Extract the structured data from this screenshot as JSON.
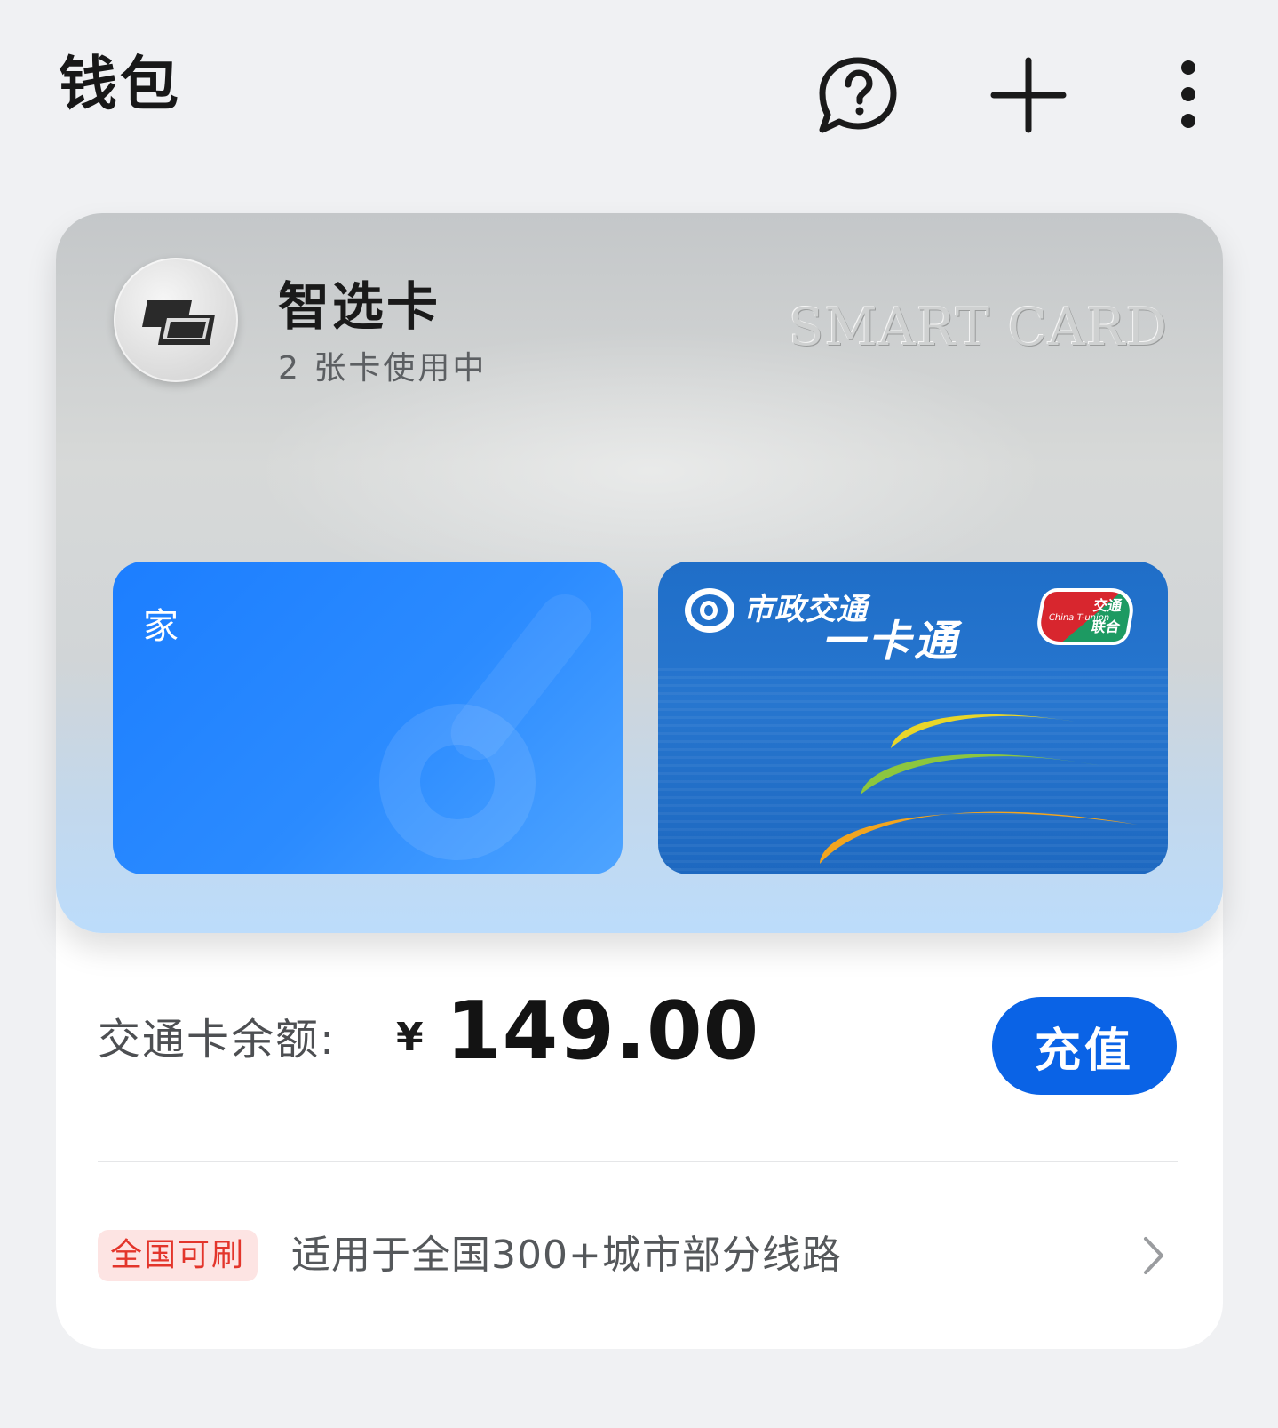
{
  "header": {
    "title": "钱包",
    "icons": [
      "help-chat-icon",
      "plus-icon",
      "more-vertical-icon"
    ]
  },
  "smart_card": {
    "name": "智选卡",
    "subtitle": "2 张卡使用中",
    "watermark": "SMART CARD",
    "cards": [
      {
        "label": "家",
        "color": "#1c7eff"
      },
      {
        "name_line1": "市政交通",
        "name_line2": "一卡通",
        "union_line1": "交通",
        "union_line2": "联合",
        "union_en": "China T-union",
        "color": "#1f6ec8"
      }
    ]
  },
  "balance": {
    "label": "交通卡余额:",
    "currency": "¥",
    "amount": "149.00"
  },
  "actions": {
    "recharge_label": "充值"
  },
  "coverage": {
    "tag": "全国可刷",
    "description": "适用于全国300+城市部分线路"
  },
  "colors": {
    "accent": "#0a63e6",
    "tag_bg": "#fde4e3",
    "tag_text": "#e3352b"
  }
}
